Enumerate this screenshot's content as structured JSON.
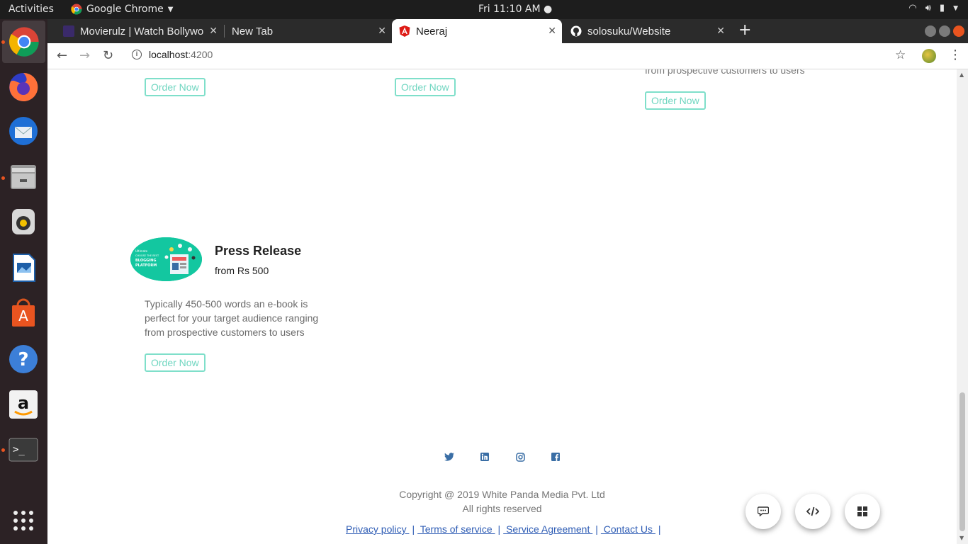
{
  "topbar": {
    "activities": "Activities",
    "app_name": "Google Chrome",
    "clock": "Fri 11:10 AM"
  },
  "browser": {
    "tabs": [
      {
        "title": "Movierulz | Watch Bollywo",
        "favicon_color": "#3a2a6a"
      },
      {
        "title": "New Tab",
        "favicon_color": ""
      },
      {
        "title": "Neeraj",
        "favicon_color": "#dd1b16"
      },
      {
        "title": "solosuku/Website",
        "favicon_color": "#ffffff"
      }
    ],
    "active_tab": 2,
    "url_host": "localhost",
    "url_port": ":4200"
  },
  "page": {
    "order_label": "Order Now",
    "faded_text": "from prospective customers to users",
    "card": {
      "title": "Press Release",
      "price": "from Rs 500",
      "description": "Typically 450-500 words an e-book is perfect for your target audience ranging from prospective customers to users",
      "image_text": [
        "Ultimate",
        "CHOOSE THE BEST",
        "BLOGGING",
        "PLATFORM"
      ]
    },
    "social_icons": [
      "twitter-icon",
      "linkedin-icon",
      "instagram-icon",
      "facebook-icon"
    ],
    "copyright": "Copyright @ 2019 White Panda Media Pvt. Ltd",
    "rights": "All rights reserved",
    "footer_links": [
      " Privacy policy ",
      " Terms of service ",
      " Service Agreement ",
      " Contact Us "
    ],
    "fabs": [
      "chat-icon",
      "code-icon",
      "grid-icon"
    ]
  },
  "colors": {
    "accent": "#6fd6c0",
    "link": "#2f5db5",
    "social": "#3a6ea5",
    "dock": "#2c2225",
    "topbar": "#1d1d1d"
  }
}
